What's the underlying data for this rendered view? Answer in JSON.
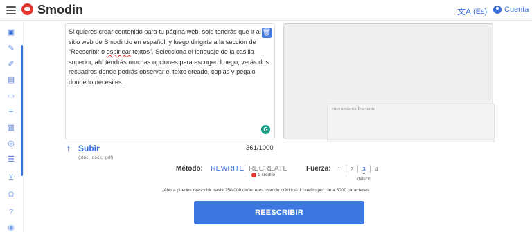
{
  "app": {
    "brand": "Smodin"
  },
  "header": {
    "language": "(Es)",
    "account": "Cuenta"
  },
  "sidebar": {
    "items": [
      {
        "icon": "rewriter-icon"
      },
      {
        "icon": "writer-icon"
      },
      {
        "icon": "pencil-icon"
      },
      {
        "icon": "chat-icon"
      },
      {
        "icon": "messages-icon"
      },
      {
        "icon": "text-lines-icon"
      },
      {
        "icon": "book-icon"
      },
      {
        "icon": "compass-icon"
      },
      {
        "icon": "list-add-icon"
      },
      {
        "icon": "cart-icon"
      },
      {
        "icon": "headset-icon"
      },
      {
        "icon": "help-icon"
      },
      {
        "icon": "user-circle-icon"
      }
    ]
  },
  "editor": {
    "text_part1": "Si quieres crear contenido para tu página web, solo tendrás que ir al sitio web de Smodin.io en español, y luego dirigirte a la sección de “Reescribir o ",
    "text_misspelled": "espinear",
    "text_part2": " textos”. Selecciona el lenguaje de la casilla superior, ahí tendrás muchas opciones para escoger. Luego, verás dos recuadros donde podrás observar el texto creado, copias y pégalo donde lo necesites.",
    "counter": "361/1000"
  },
  "history": {
    "label": "Herramienta Reciente"
  },
  "upload": {
    "label": "Subir",
    "hint": "(.doc, .docx, .pdf)"
  },
  "method": {
    "label": "Método:",
    "rewrite": "REWRITE",
    "recreate": "RECREATE",
    "credit": "1 crédito"
  },
  "force": {
    "label": "Fuerza:",
    "levels": [
      "1",
      "2",
      "3",
      "4"
    ],
    "selected": "3",
    "default_label": "defecto"
  },
  "notice": "¡Ahora puedes reescribir hasta 250 000 caracteres usando créditos! 1 crédito por cada 5000 caracteres.",
  "submit": "REESCRIBIR",
  "colors": {
    "accent": "#3d77e0",
    "brand_red": "#e0332b"
  }
}
